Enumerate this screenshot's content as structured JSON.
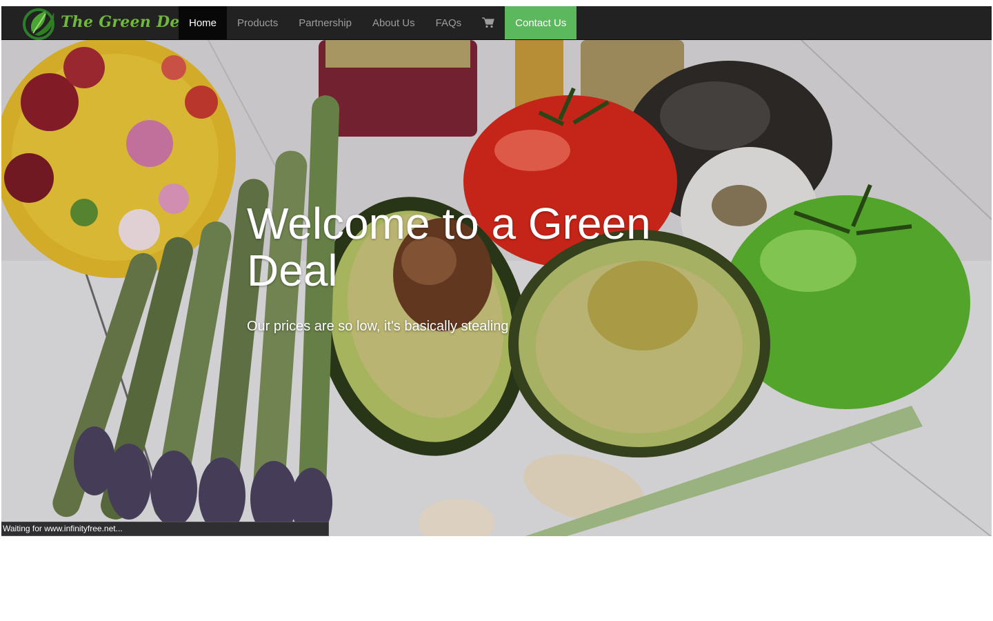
{
  "brand": {
    "name": "The Green Deal",
    "logo_icon": "leaf-logo-icon",
    "colors": {
      "primary": "#6fb83a",
      "dark": "#1e4d16"
    }
  },
  "nav": {
    "background": "#222222",
    "items": [
      {
        "label": "Home",
        "active": true
      },
      {
        "label": "Products",
        "active": false
      },
      {
        "label": "Partnership",
        "active": false
      },
      {
        "label": "About Us",
        "active": false
      },
      {
        "label": "FAQs",
        "active": false
      }
    ],
    "cart_icon": "shopping-cart-icon",
    "contact": {
      "label": "Contact Us",
      "color": "#5cb85c"
    }
  },
  "hero": {
    "title": "Welcome to a Green Deal",
    "subtitle": "Our prices are so low, it's basically stealing",
    "background_image": "vegetables-photo"
  },
  "status_bar": {
    "text": "Waiting for www.infinityfree.net..."
  }
}
